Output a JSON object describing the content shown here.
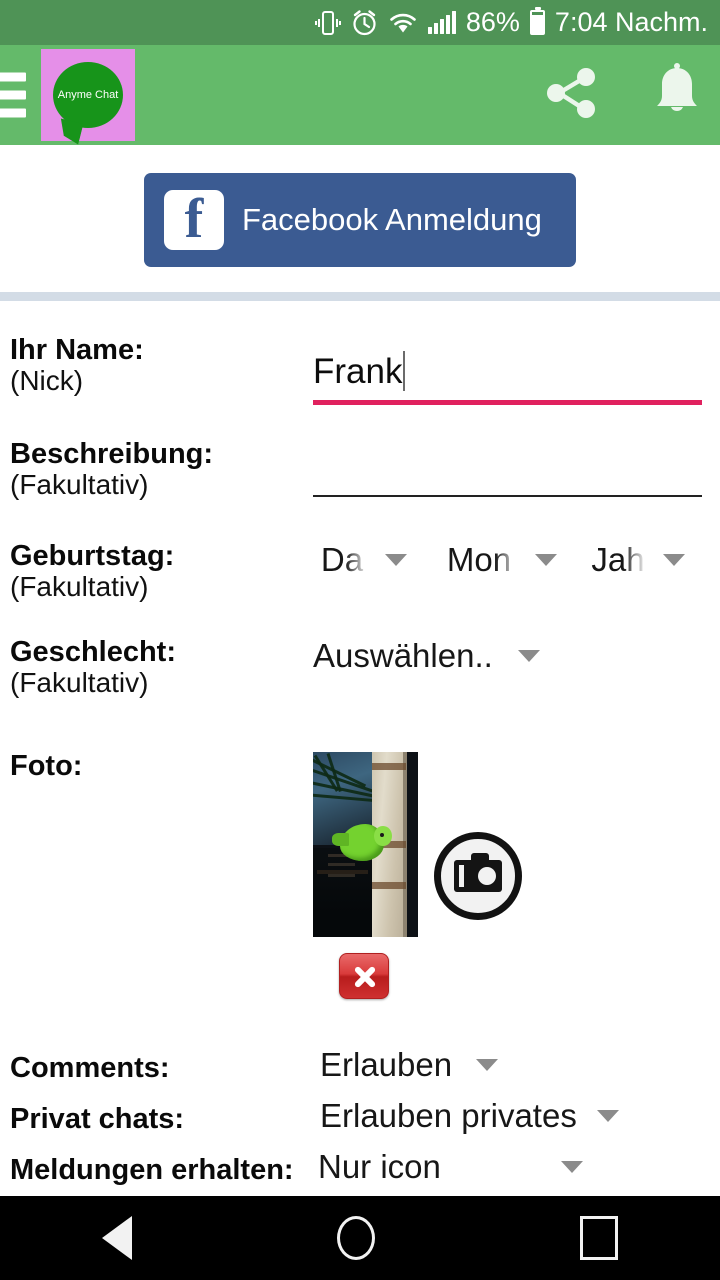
{
  "status_bar": {
    "battery_percent": "86%",
    "time": "7:04 Nachm.",
    "icons": [
      "vibrate-icon",
      "alarm-icon",
      "wifi-icon",
      "signal-icon",
      "battery-icon"
    ],
    "background": "#4f9356"
  },
  "app_bar": {
    "menu_icon": "hamburger-icon",
    "logo_text": "Anyme Chat",
    "logo_background": "#e58fe8",
    "bubble_color": "#17941a",
    "background": "#64ba6a",
    "actions": [
      "share-icon",
      "bell-icon"
    ]
  },
  "facebook": {
    "label": "Facebook Anmeldung",
    "color": "#3b5b92",
    "mark": "f"
  },
  "form": {
    "name": {
      "label": "Ihr Name:",
      "sub": "(Nick)",
      "value": "Frank",
      "underline_color": "#e0215e"
    },
    "description": {
      "label": "Beschreibung:",
      "sub": "(Fakultativ)",
      "value": ""
    },
    "birthday": {
      "label": "Geburtstag:",
      "sub": "(Fakultativ)",
      "day": "Da",
      "month": "Mon",
      "year": "Jah"
    },
    "gender": {
      "label": "Geschlecht:",
      "sub": "(Fakultativ)",
      "value": "Auswählen.."
    },
    "photo": {
      "label": "Foto:",
      "camera_icon": "camera-icon",
      "delete_icon": "delete-x-icon"
    }
  },
  "settings": [
    {
      "label": "Comments:",
      "value": "Erlauben"
    },
    {
      "label": "Privat chats:",
      "value": "Erlauben privates"
    },
    {
      "label": "Meldungen erhalten:",
      "value": "Nur icon"
    }
  ],
  "nav_bar": {
    "back": "back-triangle-icon",
    "home": "home-circle-icon",
    "recents": "recents-square-icon"
  }
}
